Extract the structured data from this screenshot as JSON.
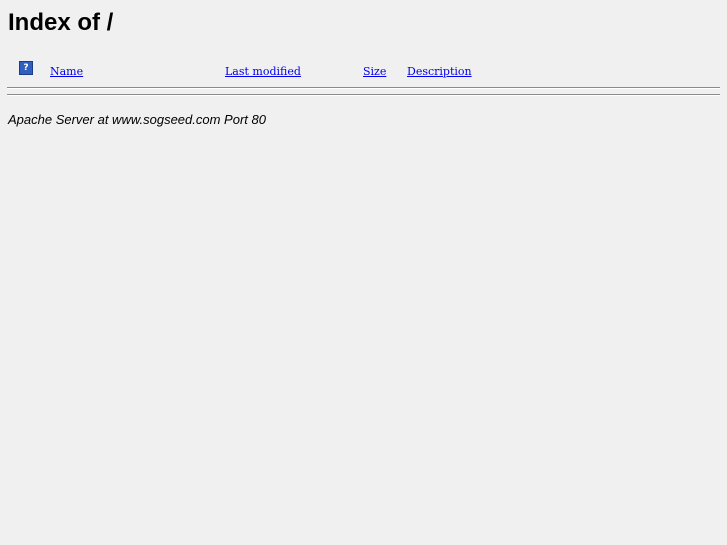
{
  "page": {
    "title": "Index of /"
  },
  "listing": {
    "header_icon": "blank-icon",
    "header_icon_glyph": "?",
    "columns": {
      "name": "Name",
      "last_modified": "Last modified",
      "size": "Size",
      "description": "Description"
    }
  },
  "footer": {
    "server_signature": "Apache Server at www.sogseed.com Port 80"
  }
}
